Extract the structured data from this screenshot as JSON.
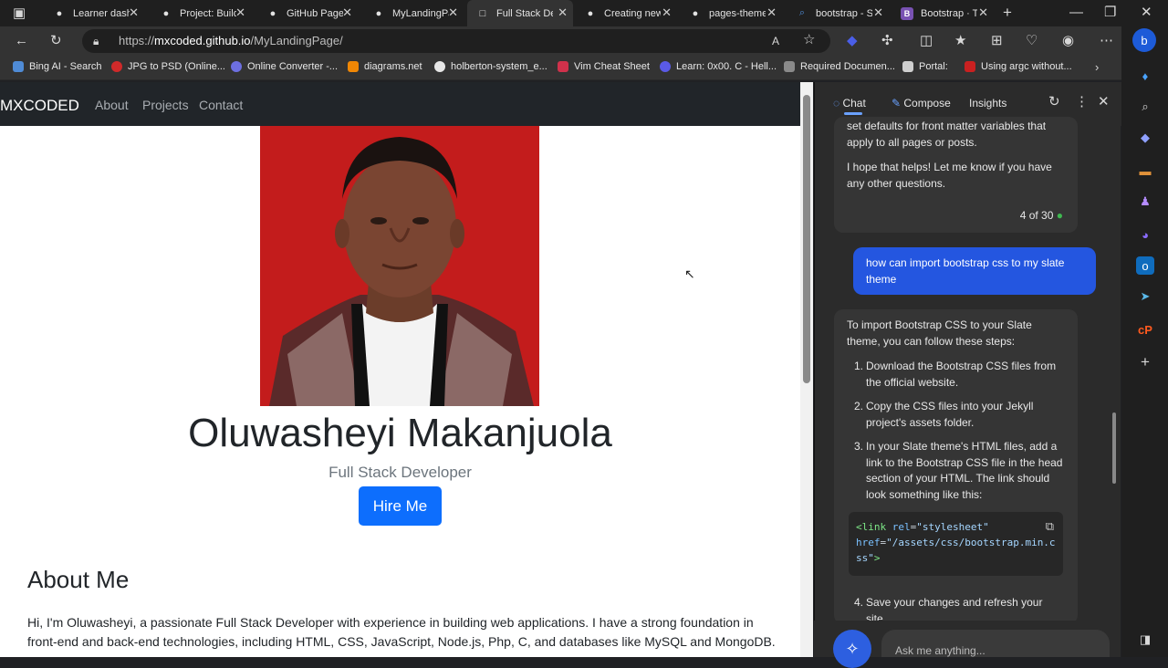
{
  "tabs": [
    {
      "title": "Learner dash",
      "icon": "github-icon"
    },
    {
      "title": "Project: Build",
      "icon": "github-icon"
    },
    {
      "title": "GitHub Pages",
      "icon": "github-icon"
    },
    {
      "title": "MyLandingPa",
      "icon": "github-icon"
    },
    {
      "title": "Full Stack De",
      "icon": "page-icon",
      "active": true
    },
    {
      "title": "Creating new",
      "icon": "github-icon"
    },
    {
      "title": "pages-theme",
      "icon": "github-icon"
    },
    {
      "title": "bootstrap - S",
      "icon": "search-icon"
    },
    {
      "title": "Bootstrap · T",
      "icon": "bootstrap-icon"
    }
  ],
  "address": {
    "prefix": "https://",
    "host": "mxcoded.github.io",
    "path": "/MyLandingPage/"
  },
  "bookmarks": [
    {
      "label": "Bing AI - Search",
      "color": "#4f8bd6"
    },
    {
      "label": "JPG to PSD (Online...",
      "color": "#d02a2a"
    },
    {
      "label": "Online Converter -...",
      "color": "#6d6fe0"
    },
    {
      "label": "diagrams.net",
      "color": "#f08705"
    },
    {
      "label": "holberton-system_e...",
      "color": "#e6e6e6"
    },
    {
      "label": "Vim Cheat Sheet",
      "color": "#d0314b"
    },
    {
      "label": "Learn: 0x00. C - Hell...",
      "color": "#5a5ae6"
    },
    {
      "label": "Required Documen...",
      "color": "#8a8a8a"
    },
    {
      "label": "Portal:",
      "color": "#cfcfcf"
    },
    {
      "label": "Using argc without...",
      "color": "#c92020"
    }
  ],
  "page": {
    "brand": "MXCODED",
    "nav": [
      "About",
      "Projects",
      "Contact"
    ],
    "name": "Oluwasheyi Makanjuola",
    "role": "Full Stack Developer",
    "hire_label": "Hire Me",
    "about_title": "About Me",
    "about_text": "Hi, I'm Oluwasheyi, a passionate Full Stack Developer with experience in building web applications. I have a strong foundation in front-end and back-end technologies, including HTML, CSS, JavaScript, Node.js, Php, C, and databases like MySQL and MongoDB."
  },
  "copilot": {
    "tabs": [
      "Chat",
      "Compose",
      "Insights"
    ],
    "msg_prev_1": "set defaults for front matter variables that apply to all pages or posts.",
    "msg_prev_2": "I hope that helps! Let me know if you have any other questions.",
    "counter": "4 of 30",
    "user_msg": "how can import bootstrap css to my slate theme",
    "answer_intro": "To import Bootstrap CSS to your Slate theme, you can follow these steps:",
    "steps": [
      "Download the Bootstrap CSS files from the official website.",
      "Copy the CSS files into your Jekyll project's assets folder.",
      "In your Slate theme's HTML files, add a link to the Bootstrap CSS file in the head section of your HTML. The link should look something like this:",
      "Save your changes and refresh your site."
    ],
    "code": {
      "tag_open": "<link",
      "rel_attr": "rel",
      "rel_val": "\"stylesheet\"",
      "href_attr": "href",
      "href_val": "\"/assets/css/bootstrap.min.css\"",
      "tag_close": ">"
    },
    "ask_placeholder": "Ask me anything..."
  },
  "colors": {
    "accent": "#0d6efd",
    "user_bubble": "#2456e0",
    "navbar": "#212529",
    "photo_bg": "#c41a1a"
  }
}
